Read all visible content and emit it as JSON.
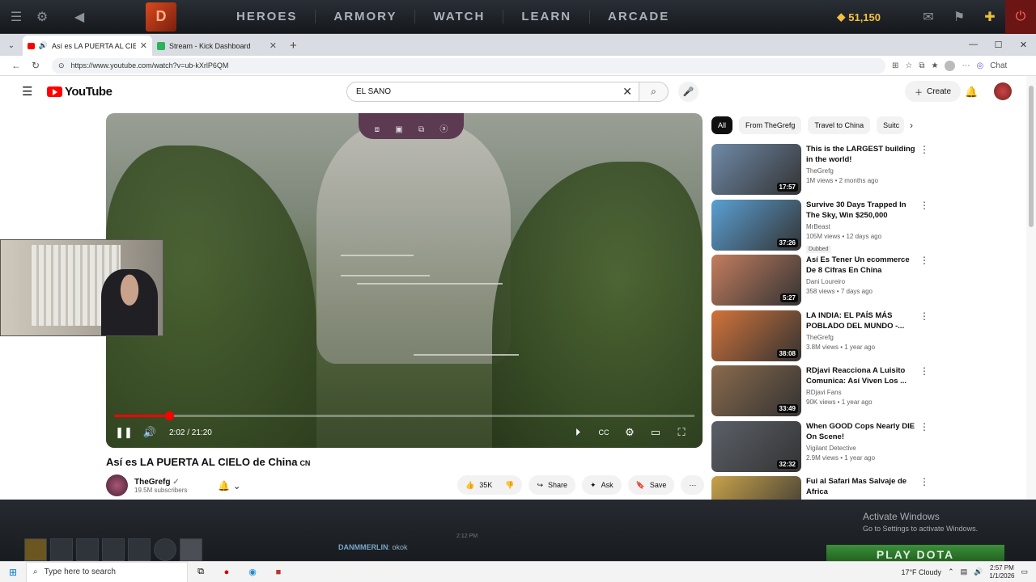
{
  "dota": {
    "nav": [
      "HEROES",
      "ARMORY",
      "WATCH",
      "LEARN",
      "ARCADE"
    ],
    "gold": "51,150"
  },
  "browser": {
    "tabs": [
      {
        "label": "Así es LA PUERTA AL CIELO de"
      },
      {
        "label": "Stream - Kick Dashboard"
      }
    ],
    "url": "https://www.youtube.com/watch?v=ub-kXrlP6QM",
    "chat_label": "Chat"
  },
  "youtube": {
    "logo": "YouTube",
    "search_value": "EL SANO",
    "create_label": "Create",
    "player": {
      "time": "2:02 / 21:20",
      "progress": 0.0953
    },
    "video_title": "Así es LA PUERTA AL CIELO de China",
    "video_flag": "CN",
    "channel": {
      "name": "TheGrefg",
      "subs": "19.5M subscribers"
    },
    "actions": {
      "likes": "35K",
      "share": "Share",
      "ask": "Ask",
      "save": "Save"
    },
    "chips": [
      "All",
      "From TheGrefg",
      "Travel to China",
      "Suitc"
    ],
    "recommendations": [
      {
        "title": "This is the LARGEST building in the world!",
        "channel": "TheGrefg",
        "meta": "1M views • 2 months ago",
        "duration": "17:57",
        "color": "#6f8aa8"
      },
      {
        "title": "Survive 30 Days Trapped In The Sky, Win $250,000",
        "channel": "MrBeast",
        "meta": "105M views • 12 days ago",
        "duration": "37:26",
        "badge": "Dubbed",
        "color": "#5aa0d4"
      },
      {
        "title": "Así Es Tener Un ecommerce De 8 Cifras En China",
        "channel": "Dani Loureiro",
        "meta": "358 views • 7 days ago",
        "duration": "5:27",
        "color": "#c47d5e"
      },
      {
        "title": "LA INDIA: EL PAÍS MÁS POBLADO DEL MUNDO -...",
        "channel": "TheGrefg",
        "meta": "3.8M views • 1 year ago",
        "duration": "38:08",
        "color": "#d2733a"
      },
      {
        "title": "RDjavi Reacciona A Luisito Comunica: Así Viven Los ...",
        "channel": "RDjavi Fans",
        "meta": "90K views • 1 year ago",
        "duration": "33:49",
        "color": "#8a6a4c"
      },
      {
        "title": "When GOOD Cops Nearly DIE On Scene!",
        "channel": "Vigilant Detective",
        "meta": "2.9M views • 1 year ago",
        "duration": "32:32",
        "color": "#5b6068"
      },
      {
        "title": "Fui al Safari Mas Salvaje de Africa",
        "channel": "",
        "meta": "",
        "duration": "",
        "color": "#c9a24a"
      }
    ]
  },
  "overlay": {
    "chat_user": "DANMMERLIN",
    "chat_msg": ": okok",
    "chat_time": "2:12 PM",
    "activate_title": "Activate Windows",
    "activate_sub": "Go to Settings to activate Windows.",
    "play_dota": "PLAY DOTA"
  },
  "taskbar": {
    "search_placeholder": "Type here to search",
    "weather": "17°F  Cloudy",
    "time": "2:57 PM",
    "date": "1/1/2026"
  }
}
